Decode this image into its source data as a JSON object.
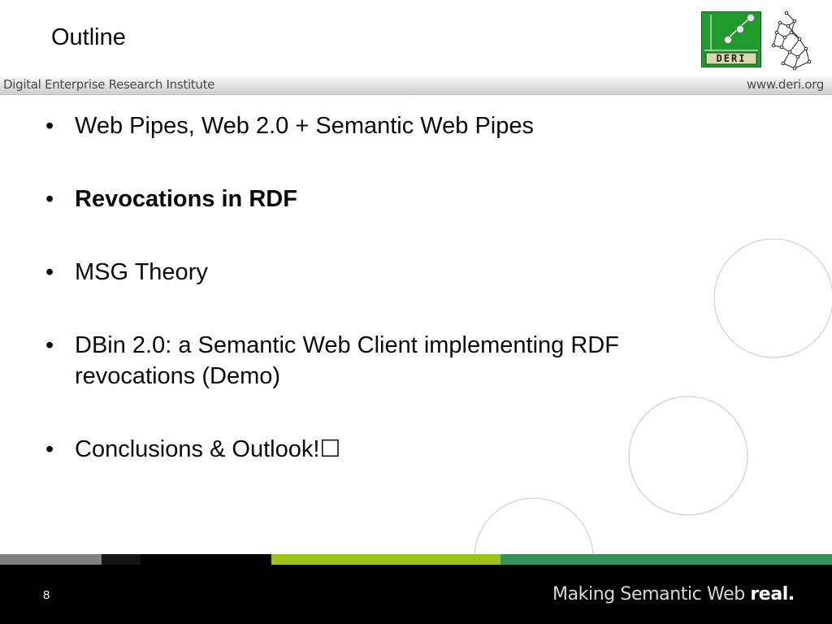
{
  "slide": {
    "title": "Outline",
    "header_left": "Digital Enterprise Research Institute",
    "header_right": "www.deri.org",
    "logo_text": "DERI",
    "bullets": [
      {
        "text": "Web Pipes, Web 2.0 + Semantic Web Pipes",
        "bold": false
      },
      {
        "text": "Revocations in RDF",
        "bold": true
      },
      {
        "text": "MSG Theory",
        "bold": false
      },
      {
        "text": "DBin 2.0: a Semantic Web Client implementing RDF revocations (Demo)",
        "bold": false
      },
      {
        "text": "Conclusions & Outlook!☐",
        "bold": false
      }
    ],
    "bullet_symbol": "•",
    "page_number": "8",
    "tagline_regular": "Making Semantic Web ",
    "tagline_bold": "real.",
    "colors": {
      "logo_green": "#1f9a2c",
      "footer_gray": "#808080",
      "footer_lime": "#9bc31a",
      "footer_green": "#35935a",
      "footer_black": "#000000"
    },
    "icons": [
      "deri-logo-icon",
      "ireland-map-icon"
    ]
  }
}
